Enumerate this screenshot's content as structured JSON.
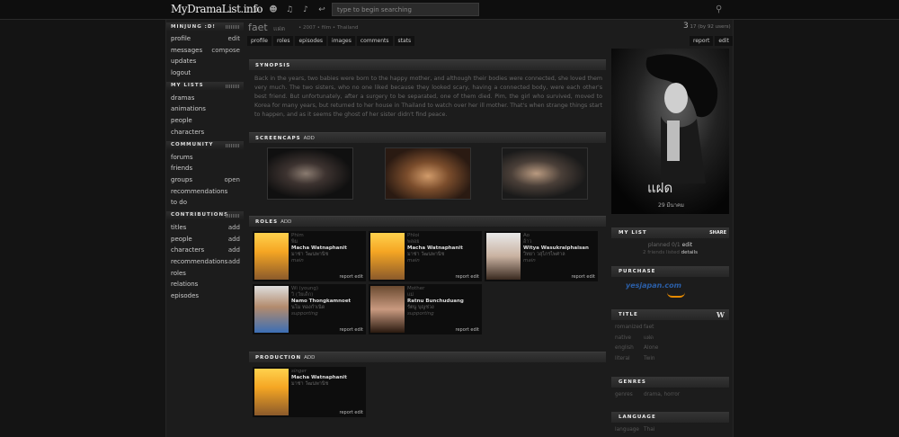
{
  "header": {
    "logo": "MyDramaList.info",
    "search_placeholder": "type to begin searching",
    "icons": [
      "home-icon",
      "users-icon",
      "bell-icon",
      "music-icon",
      "reply-icon"
    ]
  },
  "sidebar": {
    "user": {
      "title": "MINJUNG :D!",
      "items": [
        {
          "label": "profile",
          "action": "edit"
        },
        {
          "label": "messages",
          "action": "compose"
        },
        {
          "label": "updates",
          "action": ""
        },
        {
          "label": "logout",
          "action": ""
        }
      ]
    },
    "lists": {
      "title": "MY LISTS",
      "items": [
        {
          "label": "dramas",
          "action": ""
        },
        {
          "label": "animations",
          "action": ""
        },
        {
          "label": "people",
          "action": ""
        },
        {
          "label": "characters",
          "action": ""
        }
      ]
    },
    "community": {
      "title": "COMMUNITY",
      "items": [
        {
          "label": "forums",
          "action": ""
        },
        {
          "label": "friends",
          "action": ""
        },
        {
          "label": "groups",
          "action": "open"
        },
        {
          "label": "recommendations",
          "action": ""
        },
        {
          "label": "to do",
          "action": ""
        }
      ]
    },
    "contributions": {
      "title": "CONTRIBUTIONS",
      "items": [
        {
          "label": "titles",
          "action": "add"
        },
        {
          "label": "people",
          "action": "add"
        },
        {
          "label": "characters",
          "action": "add"
        },
        {
          "label": "recommendations",
          "action": "add"
        },
        {
          "label": "roles",
          "action": ""
        },
        {
          "label": "relations",
          "action": ""
        },
        {
          "label": "episodes",
          "action": ""
        }
      ]
    }
  },
  "title": {
    "name": "faet",
    "native": "แฝด",
    "meta": "• 2007  • film  • Thailand",
    "tabs": [
      "profile",
      "roles",
      "episodes",
      "images",
      "comments",
      "stats"
    ],
    "right_tabs": [
      "report",
      "edit"
    ],
    "count": "3",
    "count_note": "17 (by 92 users)"
  },
  "synopsis": {
    "heading": "SYNOPSIS",
    "text": "Back in the years, two babies were born to the happy mother, and although their bodies were connected, she loved them very much. The two sisters, who no one liked because they looked scary, having a connected body, were each other's best friend. But unfortunately, after a surgery to be separated, one of them died. Pim, the girl who survived, moved to Korea for many years, but returned to her house in Thailand to watch over her ill mother. That's when strange things start to happen, and as it seems the ghost of her sister didn't find peace."
  },
  "screencaps": {
    "heading": "SCREENCAPS",
    "add": "ADD"
  },
  "roles": {
    "heading": "ROLES",
    "add": "ADD",
    "items": [
      {
        "character": "Phim",
        "character_native": "พิม",
        "actor": "Macha Watnaphanit",
        "actor_native": "มาช่า วัฒนพานิช",
        "role": "main",
        "actions": "report edit"
      },
      {
        "character": "Phloi",
        "character_native": "พลอย",
        "actor": "Macha Watnaphanit",
        "actor_native": "มาช่า วัฒนพานิช",
        "role": "main",
        "actions": "report edit"
      },
      {
        "character": "Ao",
        "character_native": "อ้าว",
        "actor": "Witya Wasukraiphaisan",
        "actor_native": "วิทยา วสุไกรไพศาล",
        "role": "main",
        "actions": "report edit"
      },
      {
        "character": "Wi (young)",
        "character_native": "วิ (วัยเด็ก)",
        "actor": "Namo Thongkamnoet",
        "actor_native": "นโม ทองกำเนิด",
        "role": "supporting",
        "actions": "report edit"
      },
      {
        "character": "Mother",
        "character_native": "แม่",
        "actor": "Ratnu Bunchuduang",
        "actor_native": "รัตนู บุญช่วง",
        "role": "supporting",
        "actions": "report edit"
      }
    ]
  },
  "production": {
    "heading": "PRODUCTION",
    "add": "ADD",
    "items": [
      {
        "role": "singer",
        "person": "Macha Watnaphanit",
        "person_native": "มาช่า วัฒนพานิช",
        "actions": "report edit"
      }
    ]
  },
  "my_list": {
    "heading": "MY LIST",
    "share": "SHARE",
    "status": "planned 0/1",
    "edit": "edit",
    "friends": "2 friends listed",
    "details": "details"
  },
  "purchase": {
    "heading": "PURCHASE",
    "store": "yesjapan.com"
  },
  "title_info": {
    "heading": "TITLE",
    "rows": [
      {
        "k": "romanized",
        "v": "faet"
      },
      {
        "k": "native",
        "v": "แฝด"
      },
      {
        "k": "english",
        "v": "Alone"
      },
      {
        "k": "literal",
        "v": "Twin"
      }
    ]
  },
  "genres": {
    "heading": "GENRES",
    "rows": [
      {
        "k": "genres",
        "v": "drama, horror"
      }
    ]
  },
  "language": {
    "heading": "LANGUAGE",
    "rows": [
      {
        "k": "language",
        "v": "Thai"
      }
    ]
  },
  "poster": {
    "text": "แฝด",
    "date": "29 มีนาคม"
  }
}
